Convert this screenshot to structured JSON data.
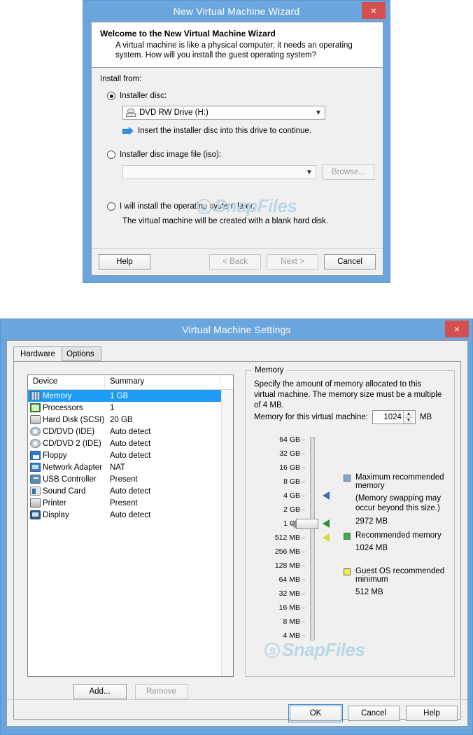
{
  "wizard": {
    "title": "New Virtual Machine Wizard",
    "close_label": "×",
    "header_title": "Welcome to the New Virtual Machine Wizard",
    "header_text": "A virtual machine is like a physical computer; it needs an operating system. How will you install the guest operating system?",
    "install_from_label": "Install from:",
    "option_disc_label": "Installer disc:",
    "drive_value": "DVD RW Drive (H:)",
    "drive_hint": "Insert the installer disc into this drive to continue.",
    "option_iso_label": "Installer disc image file (iso):",
    "iso_value": "",
    "browse_label": "Browse...",
    "option_later_label": "I will install the operating system later.",
    "later_hint": "The virtual machine will be created with a blank hard disk.",
    "buttons": {
      "help": "Help",
      "back": "< Back",
      "next": "Next >",
      "cancel": "Cancel"
    }
  },
  "settings": {
    "title": "Virtual Machine Settings",
    "close_label": "×",
    "tabs": [
      {
        "label": "Hardware",
        "active": true
      },
      {
        "label": "Options",
        "active": false
      }
    ],
    "device_columns": [
      "Device",
      "Summary"
    ],
    "devices": [
      {
        "name": "Memory",
        "summary": "1 GB",
        "icon": "memory-icon",
        "selected": true
      },
      {
        "name": "Processors",
        "summary": "1",
        "icon": "cpu-icon",
        "selected": false
      },
      {
        "name": "Hard Disk (SCSI)",
        "summary": "20 GB",
        "icon": "hdd-icon",
        "selected": false
      },
      {
        "name": "CD/DVD (IDE)",
        "summary": "Auto detect",
        "icon": "cd-icon",
        "selected": false
      },
      {
        "name": "CD/DVD 2 (IDE)",
        "summary": "Auto detect",
        "icon": "cd-icon",
        "selected": false
      },
      {
        "name": "Floppy",
        "summary": "Auto detect",
        "icon": "floppy-icon",
        "selected": false
      },
      {
        "name": "Network Adapter",
        "summary": "NAT",
        "icon": "network-icon",
        "selected": false
      },
      {
        "name": "USB Controller",
        "summary": "Present",
        "icon": "usb-icon",
        "selected": false
      },
      {
        "name": "Sound Card",
        "summary": "Auto detect",
        "icon": "sound-icon",
        "selected": false
      },
      {
        "name": "Printer",
        "summary": "Present",
        "icon": "printer-icon",
        "selected": false
      },
      {
        "name": "Display",
        "summary": "Auto detect",
        "icon": "display-icon",
        "selected": false
      }
    ],
    "add_label": "Add...",
    "remove_label": "Remove",
    "memory": {
      "group_label": "Memory",
      "description": "Specify the amount of memory allocated to this virtual machine. The memory size must be a multiple of 4 MB.",
      "field_label": "Memory for this virtual machine:",
      "value": "1024",
      "unit": "MB",
      "ticks": [
        "64 GB",
        "32 GB",
        "16 GB",
        "8 GB",
        "4 GB",
        "2 GB",
        "1 GB",
        "512 MB",
        "256 MB",
        "128 MB",
        "64 MB",
        "32 MB",
        "16 MB",
        "8 MB",
        "4 MB"
      ],
      "slider_position_tick": "1 GB",
      "markers": [
        {
          "at_tick": "4 GB",
          "color": "#3f6fa8"
        },
        {
          "at_tick": "1 GB",
          "color": "#2f8f2f"
        },
        {
          "at_tick": "512 MB",
          "color": "#d8d83a"
        }
      ],
      "legend": [
        {
          "color": "#7fa8cc",
          "title": "Maximum recommended memory",
          "note": "(Memory swapping may occur beyond this size.)",
          "value": "2972 MB"
        },
        {
          "color": "#3fae3f",
          "title": "Recommended memory",
          "note": "",
          "value": "1024 MB"
        },
        {
          "color": "#eded4a",
          "title": "Guest OS recommended minimum",
          "note": "",
          "value": "512 MB"
        }
      ]
    },
    "buttons": {
      "ok": "OK",
      "cancel": "Cancel",
      "help": "Help"
    }
  },
  "watermark": {
    "text": "SnapFiles",
    "badge": "S"
  }
}
